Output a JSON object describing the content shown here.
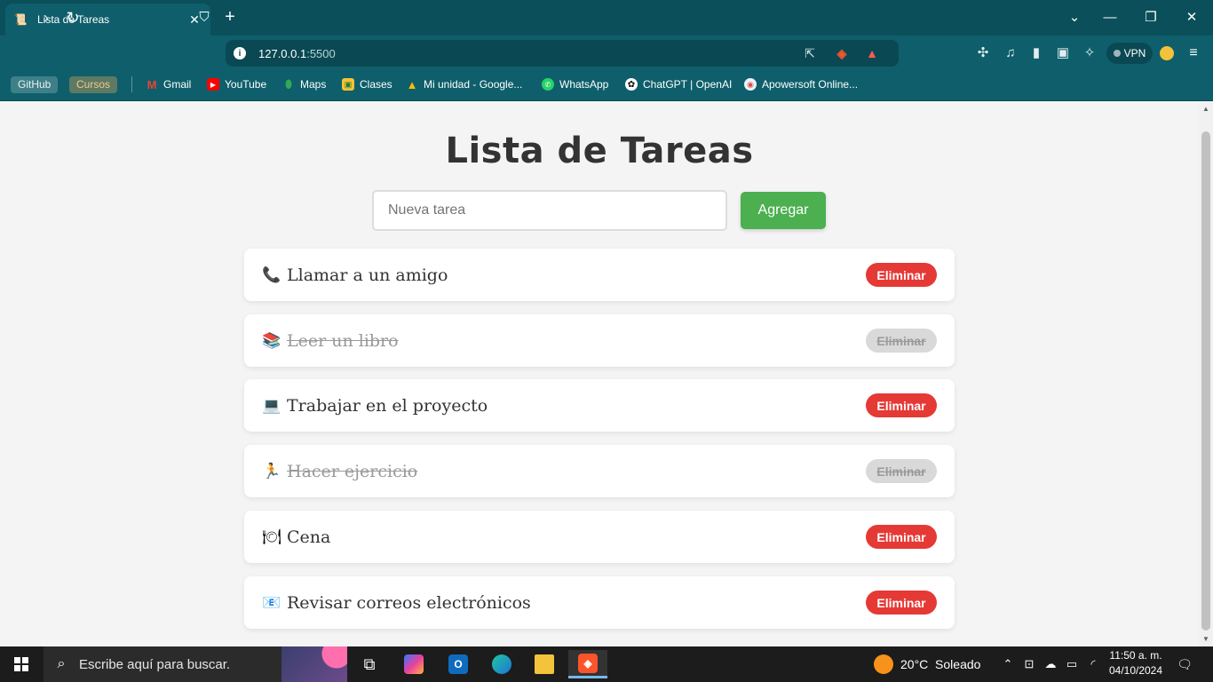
{
  "browser": {
    "tab_title": "Lista de Tareas",
    "tab_close": "✕",
    "new_tab": "+",
    "window_controls": {
      "dropdown": "⌄",
      "minimize": "—",
      "restore": "❐",
      "close": "✕"
    },
    "url_host": "127.0.0.1",
    "url_port": ":5500",
    "vpn_label": "VPN",
    "bookmarks": [
      {
        "label": "GitHub"
      },
      {
        "label": "Cursos"
      },
      {
        "label": "Gmail",
        "icon": "gmail-icon"
      },
      {
        "label": "YouTube",
        "icon": "youtube-icon"
      },
      {
        "label": "Maps",
        "icon": "maps-icon"
      },
      {
        "label": "Clases",
        "icon": "classroom-icon"
      },
      {
        "label": "Mi unidad - Google...",
        "icon": "drive-icon"
      },
      {
        "label": "WhatsApp",
        "icon": "whatsapp-icon"
      },
      {
        "label": "ChatGPT | OpenAI",
        "icon": "openai-icon"
      },
      {
        "label": "Apowersoft Online...",
        "icon": "apowersoft-icon"
      }
    ]
  },
  "page": {
    "title": "Lista de Tareas",
    "input_placeholder": "Nueva tarea",
    "add_button": "Agregar",
    "tasks": [
      {
        "emoji": "📞",
        "text": "Llamar a un amigo",
        "done": false,
        "delete_label": "Eliminar"
      },
      {
        "emoji": "📚",
        "text": "Leer un libro",
        "done": true,
        "delete_label": "Eliminar"
      },
      {
        "emoji": "💻",
        "text": "Trabajar en el proyecto",
        "done": false,
        "delete_label": "Eliminar"
      },
      {
        "emoji": "🏃",
        "text": "Hacer ejercicio",
        "done": true,
        "delete_label": "Eliminar"
      },
      {
        "emoji": "🍽",
        "text": "Cena",
        "done": false,
        "delete_label": "Eliminar"
      },
      {
        "emoji": "📧",
        "text": "Revisar correos electrónicos",
        "done": false,
        "delete_label": "Eliminar"
      }
    ]
  },
  "taskbar": {
    "search_placeholder": "Escribe aquí para buscar.",
    "weather": "20°C  Soleado",
    "time": "11:50 a. m.",
    "date": "04/10/2024"
  },
  "colors": {
    "accent_green": "#4caf50",
    "delete_red": "#e53935",
    "browser_teal": "#0e5f6b"
  }
}
